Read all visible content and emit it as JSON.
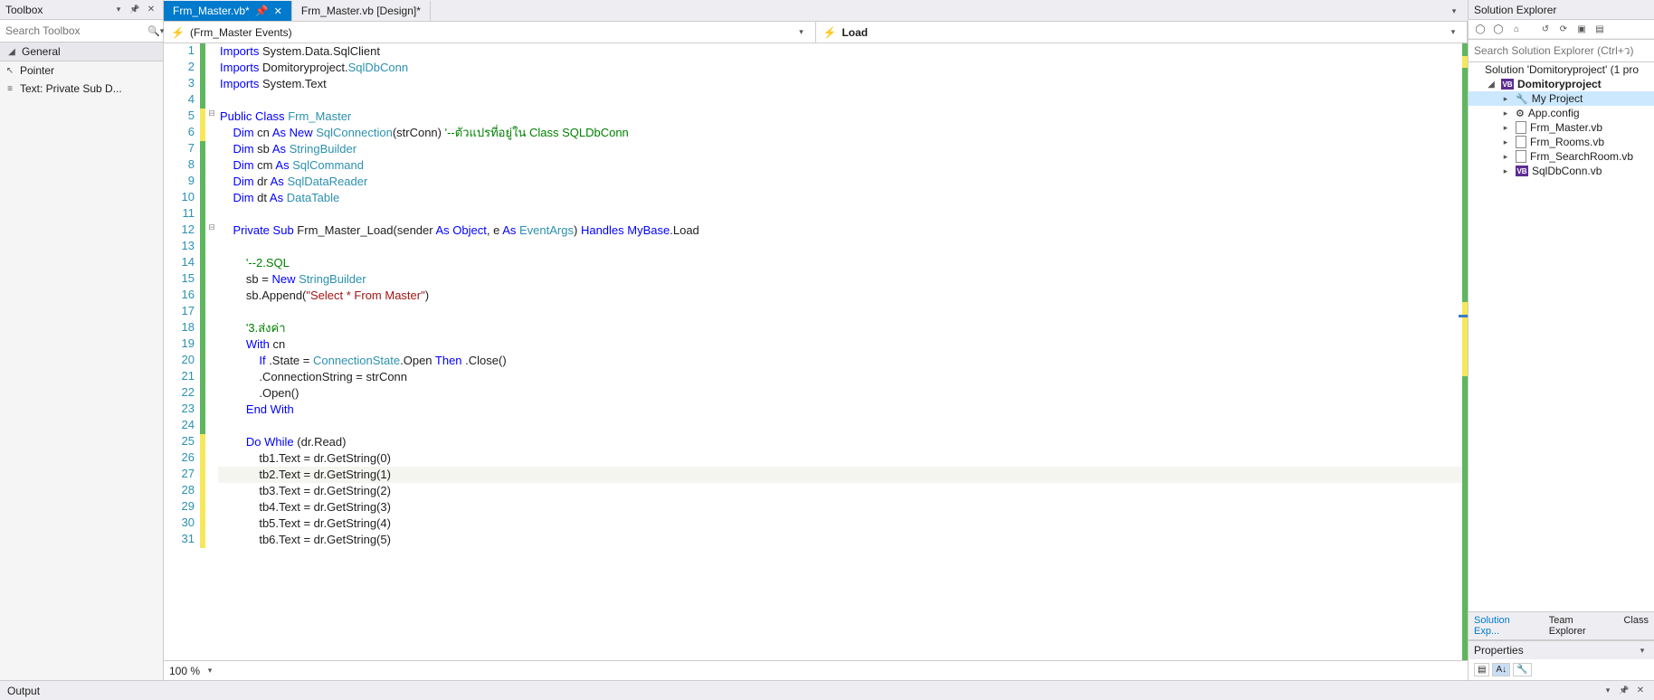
{
  "toolbox": {
    "title": "Toolbox",
    "search_placeholder": "Search Toolbox",
    "section": "General",
    "items": [
      {
        "icon": "pointer",
        "label": "Pointer"
      },
      {
        "icon": "text",
        "label": "Text: Private Sub D..."
      }
    ]
  },
  "tabs": [
    {
      "label": "Frm_Master.vb*",
      "active": true,
      "pinned": true
    },
    {
      "label": "Frm_Master.vb [Design]*",
      "active": false
    }
  ],
  "nav": {
    "left": "(Frm_Master Events)",
    "right": "Load"
  },
  "zoom": "100 %",
  "code": {
    "current_line": 27,
    "lines": [
      {
        "n": 1,
        "m": "g",
        "html": "<span class='kw'>Imports</span> System.Data.SqlClient"
      },
      {
        "n": 2,
        "m": "g",
        "html": "<span class='kw'>Imports</span> Domitoryproject.<span class='typ'>SqlDbConn</span>"
      },
      {
        "n": 3,
        "m": "g",
        "html": "<span class='kw'>Imports</span> System.Text"
      },
      {
        "n": 4,
        "m": "g",
        "html": ""
      },
      {
        "n": 5,
        "m": "y",
        "fold": "⊟",
        "html": "<span class='kw'>Public</span> <span class='kw'>Class</span> <span class='typ'>Frm_Master</span>"
      },
      {
        "n": 6,
        "m": "y",
        "html": "    <span class='kw'>Dim</span> cn <span class='kw'>As</span> <span class='kw'>New</span> <span class='typ'>SqlConnection</span>(strConn) <span class='cm'>'--ตัวแปรที่อยู่ใน Class SQLDbConn</span>"
      },
      {
        "n": 7,
        "m": "g",
        "html": "    <span class='kw'>Dim</span> sb <span class='kw'>As</span> <span class='typ'>StringBuilder</span>"
      },
      {
        "n": 8,
        "m": "g",
        "html": "    <span class='kw'>Dim</span> cm <span class='kw'>As</span> <span class='typ'>SqlCommand</span>"
      },
      {
        "n": 9,
        "m": "g",
        "html": "    <span class='kw'>Dim</span> dr <span class='kw'>As</span> <span class='typ'>SqlDataReader</span>"
      },
      {
        "n": 10,
        "m": "g",
        "html": "    <span class='kw'>Dim</span> dt <span class='kw'>As</span> <span class='typ'>DataTable</span>"
      },
      {
        "n": 11,
        "m": "g",
        "html": ""
      },
      {
        "n": 12,
        "m": "g",
        "fold": "⊟",
        "html": "    <span class='kw'>Private</span> <span class='kw'>Sub</span> Frm_Master_Load(sender <span class='kw'>As</span> <span class='kw'>Object</span>, e <span class='kw'>As</span> <span class='typ'>EventArgs</span>) <span class='kw'>Handles</span> <span class='kw'>MyBase</span>.Load"
      },
      {
        "n": 13,
        "m": "g",
        "html": ""
      },
      {
        "n": 14,
        "m": "g",
        "html": "        <span class='cm'>'--2.SQL</span>"
      },
      {
        "n": 15,
        "m": "g",
        "html": "        sb = <span class='kw'>New</span> <span class='typ'>StringBuilder</span>"
      },
      {
        "n": 16,
        "m": "g",
        "html": "        sb.Append(<span class='str'>\"Select * From Master\"</span>)"
      },
      {
        "n": 17,
        "m": "g",
        "html": ""
      },
      {
        "n": 18,
        "m": "g",
        "html": "        <span class='cm'>'3.ส่งค่า</span>"
      },
      {
        "n": 19,
        "m": "g",
        "html": "        <span class='kw'>With</span> cn"
      },
      {
        "n": 20,
        "m": "g",
        "html": "            <span class='kw'>If</span> .State = <span class='typ'>ConnectionState</span>.Open <span class='kw'>Then</span> .Close()"
      },
      {
        "n": 21,
        "m": "g",
        "html": "            .ConnectionString = strConn"
      },
      {
        "n": 22,
        "m": "g",
        "html": "            .Open()"
      },
      {
        "n": 23,
        "m": "g",
        "html": "        <span class='kw'>End</span> <span class='kw'>With</span>"
      },
      {
        "n": 24,
        "m": "g",
        "html": ""
      },
      {
        "n": 25,
        "m": "y",
        "html": "        <span class='kw'>Do</span> <span class='kw'>While</span> (dr.Read)"
      },
      {
        "n": 26,
        "m": "y",
        "html": "            tb1.Text = dr.GetString(0)"
      },
      {
        "n": 27,
        "m": "y",
        "html": "            tb2.Text = dr.GetString(1)"
      },
      {
        "n": 28,
        "m": "y",
        "html": "            tb3.Text = dr.GetString(2)"
      },
      {
        "n": 29,
        "m": "y",
        "html": "            tb4.Text = dr.GetString(3)"
      },
      {
        "n": 30,
        "m": "y",
        "html": "            tb5.Text = dr.GetString(4)"
      },
      {
        "n": 31,
        "m": "y",
        "html": "            tb6.Text = dr.GetString(5)"
      }
    ]
  },
  "solution_explorer": {
    "title": "Solution Explorer",
    "search_placeholder": "Search Solution Explorer (Ctrl+ว)",
    "solution": "Solution 'Domitoryproject' (1 pro",
    "project": "Domitoryproject",
    "items": [
      {
        "icon": "wrench",
        "label": "My Project",
        "sel": true
      },
      {
        "icon": "cfg",
        "label": "App.config"
      },
      {
        "icon": "file",
        "label": "Frm_Master.vb"
      },
      {
        "icon": "file",
        "label": "Frm_Rooms.vb"
      },
      {
        "icon": "file",
        "label": "Frm_SearchRoom.vb"
      },
      {
        "icon": "vb",
        "label": "SqlDbConn.vb"
      }
    ],
    "tabs": [
      "Solution Exp...",
      "Team Explorer",
      "Class"
    ]
  },
  "properties": {
    "title": "Properties"
  },
  "output": {
    "title": "Output"
  }
}
